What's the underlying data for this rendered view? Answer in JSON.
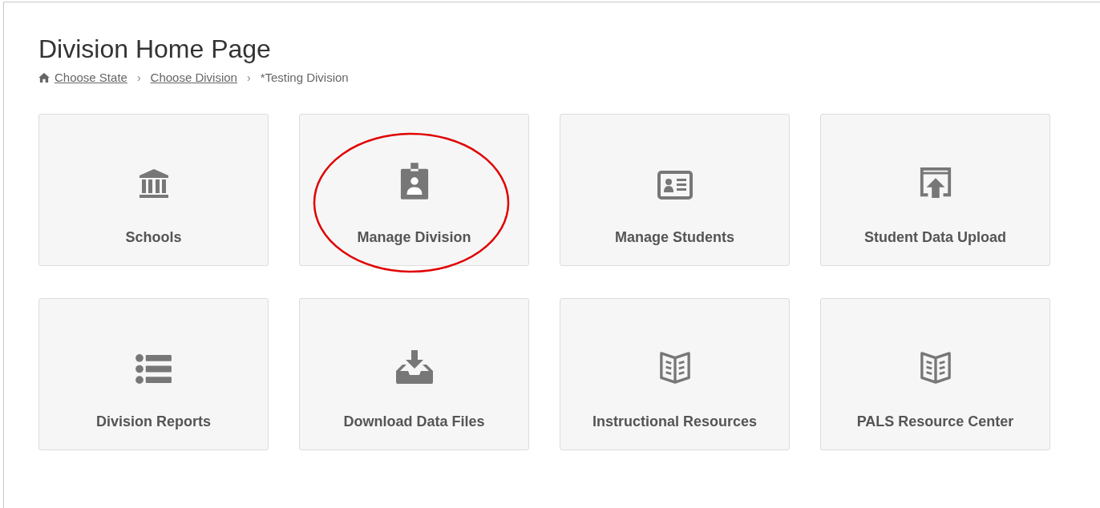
{
  "page": {
    "title": "Division Home Page"
  },
  "breadcrumb": [
    {
      "label": "Choose State",
      "kind": "link"
    },
    {
      "label": "Choose Division",
      "kind": "link"
    },
    {
      "label": "*Testing Division",
      "kind": "current"
    }
  ],
  "breadcrumb_separators": [
    "›",
    "›"
  ],
  "tiles": [
    {
      "label": "Schools",
      "kind": "bank",
      "circled": false
    },
    {
      "label": "Manage Division",
      "kind": "badge",
      "circled": true
    },
    {
      "label": "Manage Students",
      "kind": "idcard",
      "circled": false
    },
    {
      "label": "Student Data Upload",
      "kind": "upload",
      "circled": false
    },
    {
      "label": "Division Reports",
      "kind": "list",
      "circled": false
    },
    {
      "label": "Download Data Files",
      "kind": "download",
      "circled": false
    },
    {
      "label": "Instructional Resources",
      "kind": "book",
      "circled": false
    },
    {
      "label": "PALS Resource Center",
      "kind": "book",
      "circled": false
    }
  ]
}
